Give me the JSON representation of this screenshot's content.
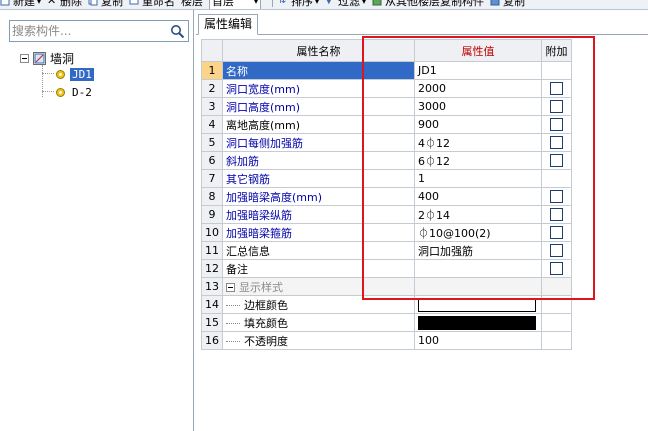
{
  "toolbar": {
    "items": [
      {
        "icon": "new-icon",
        "label": "新建",
        "dropdown": true
      },
      {
        "icon": "delete-icon",
        "label": "删除"
      },
      {
        "icon": "copy-icon",
        "label": "复制"
      },
      {
        "icon": "rename-icon",
        "label": "重命名"
      },
      {
        "label": "楼层"
      },
      {
        "label": "首层",
        "dropdown": true
      },
      {
        "icon": "sort-icon",
        "label": "排序",
        "dropdown": true
      },
      {
        "icon": "filter-icon",
        "label": "过滤",
        "dropdown": true
      },
      {
        "icon": "copy-from-floor-icon",
        "label": "从其他楼层复制构件"
      },
      {
        "icon": "copy-to-icon",
        "label": "复制"
      }
    ]
  },
  "search": {
    "placeholder": "搜索构件..."
  },
  "tree": {
    "root": {
      "label": "墙洞",
      "icon": "wall-opening-folder-icon"
    },
    "children": [
      {
        "label": "JD1",
        "selected": true,
        "icon": "gear-icon"
      },
      {
        "label": "D-2",
        "selected": false,
        "icon": "gear-icon"
      }
    ]
  },
  "tab": {
    "label": "属性编辑"
  },
  "grid": {
    "headers": {
      "name": "属性名称",
      "value": "属性值",
      "extra": "附加"
    },
    "rows": [
      {
        "idx": "1",
        "name": "名称",
        "value": "JD1",
        "check": false
      },
      {
        "idx": "2",
        "name": "洞口宽度(mm)",
        "value": "2000",
        "check": true
      },
      {
        "idx": "3",
        "name": "洞口高度(mm)",
        "value": "3000",
        "check": true
      },
      {
        "idx": "4",
        "name": "离地高度(mm)",
        "value": "900",
        "check": true
      },
      {
        "idx": "5",
        "name": "洞口每侧加强筋",
        "value": "4⏀12",
        "check": true
      },
      {
        "idx": "6",
        "name": "斜加筋",
        "value": "6⏀12",
        "check": true
      },
      {
        "idx": "7",
        "name": "其它钢筋",
        "value": "1",
        "check": false
      },
      {
        "idx": "8",
        "name": "加强暗梁高度(mm)",
        "value": "400",
        "check": true
      },
      {
        "idx": "9",
        "name": "加强暗梁纵筋",
        "value": "2⏀14",
        "check": true
      },
      {
        "idx": "10",
        "name": "加强暗梁箍筋",
        "value": "⏀10@100(2)",
        "check": true
      },
      {
        "idx": "11",
        "name": "汇总信息",
        "value": "洞口加强筋",
        "check": true
      },
      {
        "idx": "12",
        "name": "备注",
        "value": "",
        "check": true
      },
      {
        "idx": "13",
        "name": "显示样式",
        "value": "",
        "check": false
      },
      {
        "idx": "14",
        "name": "边框颜色",
        "value": "",
        "check": false
      },
      {
        "idx": "15",
        "name": "填充颜色",
        "value": "",
        "check": false
      },
      {
        "idx": "16",
        "name": "不透明度",
        "value": "100",
        "check": false
      }
    ]
  },
  "colors": {
    "selection": "#3169c6",
    "header_highlight": "#fbd48a",
    "header_highlight_text": "#c00000",
    "annotation_box": "#e0141e",
    "border_color_swatch": "#ffffff",
    "fill_color_swatch": "#000000"
  }
}
